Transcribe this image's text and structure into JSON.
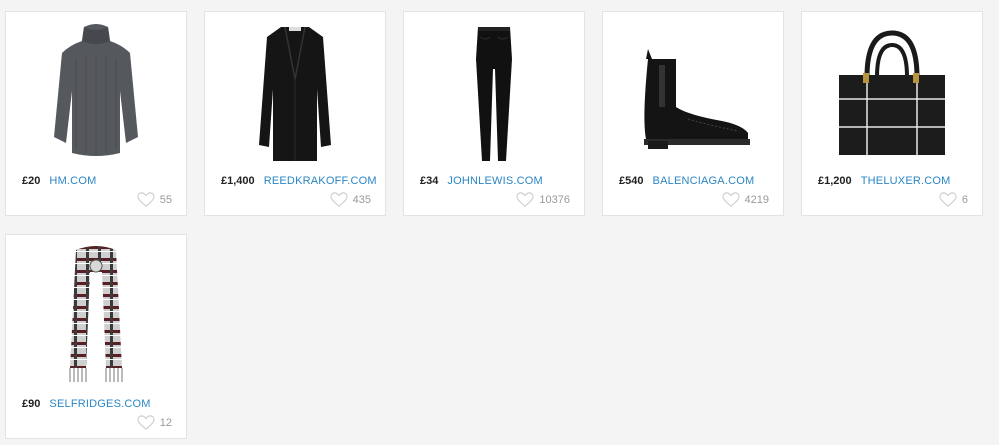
{
  "products": [
    {
      "price": "£20",
      "store": "HM.COM",
      "likes": "55",
      "image": "grey-turtleneck-sweater"
    },
    {
      "price": "£1,400",
      "store": "REEDKRAKOFF.COM",
      "likes": "435",
      "image": "black-long-coat"
    },
    {
      "price": "£34",
      "store": "JOHNLEWIS.COM",
      "likes": "10376",
      "image": "black-skinny-jeans"
    },
    {
      "price": "£540",
      "store": "BALENCIAGA.COM",
      "likes": "4219",
      "image": "black-chelsea-boot"
    },
    {
      "price": "£1,200",
      "store": "THELUXER.COM",
      "likes": "6",
      "image": "black-tote-bag"
    },
    {
      "price": "£90",
      "store": "SELFRIDGES.COM",
      "likes": "12",
      "image": "plaid-scarf"
    }
  ],
  "colors": {
    "link": "#2a86c4",
    "price": "#222222",
    "likes": "#999999",
    "background": "#f4f4f4"
  },
  "icons": {
    "like": "heart-icon"
  }
}
